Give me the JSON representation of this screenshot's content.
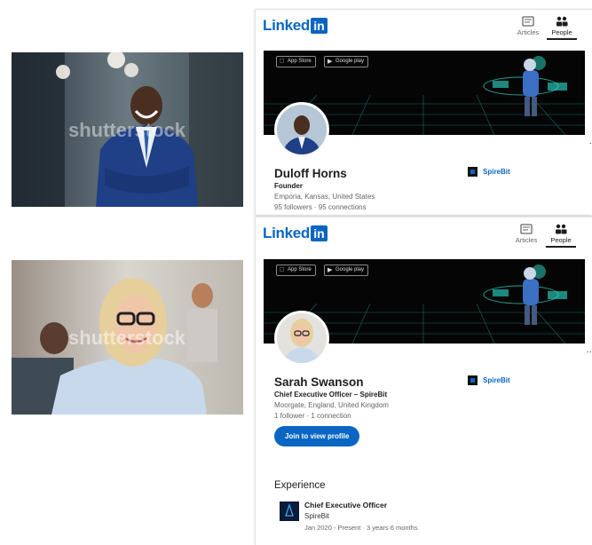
{
  "watermark": "shutterstock",
  "cards": [
    {
      "logo_text": "Linked",
      "logo_in": "in",
      "nav": [
        {
          "label": "Articles",
          "icon": "articles-icon"
        },
        {
          "label": "People",
          "icon": "people-icon"
        }
      ],
      "badges": [
        "App Store",
        "Google play"
      ],
      "name": "Duloff Horns",
      "headline": "Founder",
      "location": "Emporia, Kansas, United States",
      "stats": "95 followers · 95 connections",
      "company": "SpireBit"
    },
    {
      "logo_text": "Linked",
      "logo_in": "in",
      "nav": [
        {
          "label": "Articles",
          "icon": "articles-icon"
        },
        {
          "label": "People",
          "icon": "people-icon"
        }
      ],
      "badges": [
        "App Store",
        "Google play"
      ],
      "name": "Sarah Swanson",
      "headline": "Chief Executive Officer – SpireBit",
      "location": "Moorgate, England, United Kingdom",
      "stats": "1 follower · 1 connection",
      "company": "SpireBit",
      "join_button": "Join to view profile",
      "experience": {
        "section_title": "Experience",
        "title": "Chief Executive Officer",
        "company": "SpireBit",
        "dates": "Jan 2020 - Present · 3 years 6 months"
      }
    }
  ],
  "colors": {
    "linkedin_blue": "#0a66c2",
    "banner_bg": "#050505",
    "neon": "#2de0d0"
  }
}
